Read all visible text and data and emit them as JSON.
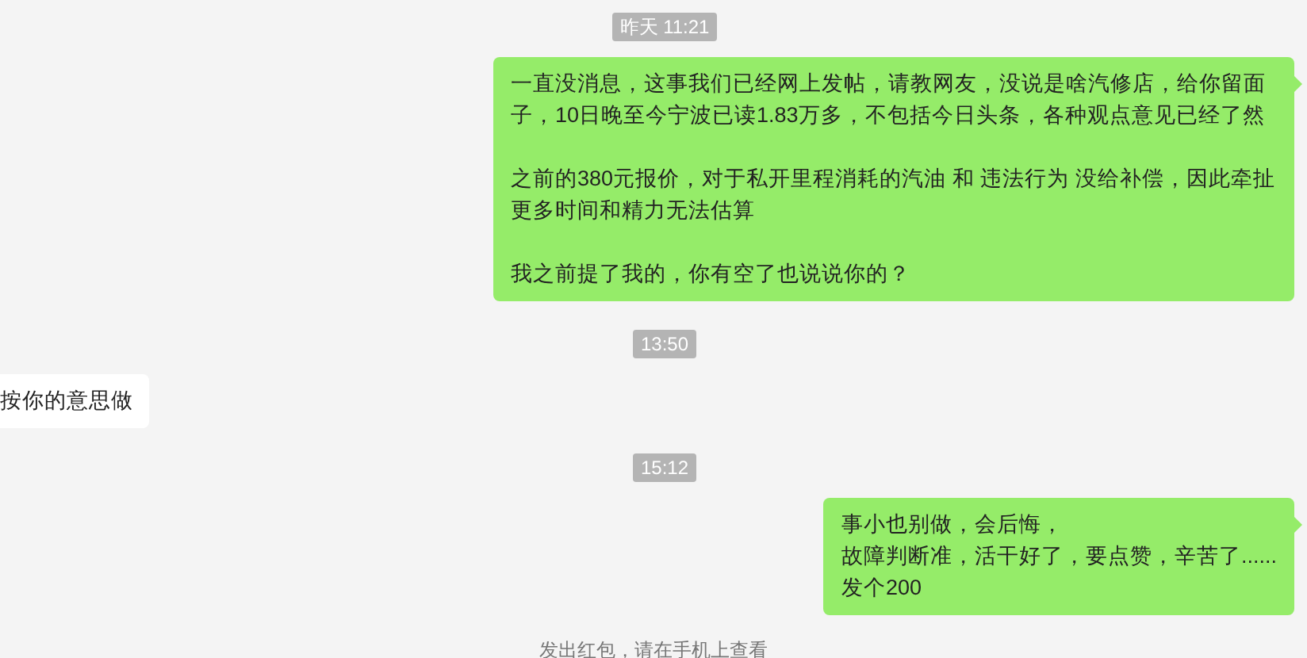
{
  "messages": [
    {
      "kind": "time",
      "text": "昨天 11:21"
    },
    {
      "kind": "outgoing",
      "paragraphs": [
        "一直没消息，这事我们已经网上发帖，请教网友，没说是啥汽修店，给你留面子，10日晚至今宁波已读1.83万多，不包括今日头条，各种观点意见已经了然",
        "之前的380元报价，对于私开里程消耗的汽油 和 违法行为 没给补偿，因此牵扯更多时间和精力无法估算",
        "我之前提了我的，你有空了也说说你的？"
      ]
    },
    {
      "kind": "time",
      "text": "13:50"
    },
    {
      "kind": "incoming",
      "text": "按你的意思做"
    },
    {
      "kind": "time",
      "text": "15:12"
    },
    {
      "kind": "outgoing",
      "lines": [
        "事小也别做，会后悔，",
        "故障判断准，活干好了，要点赞，辛苦了......",
        "发个200"
      ]
    },
    {
      "kind": "system",
      "text": "发出红包，请在手机上查看"
    }
  ]
}
